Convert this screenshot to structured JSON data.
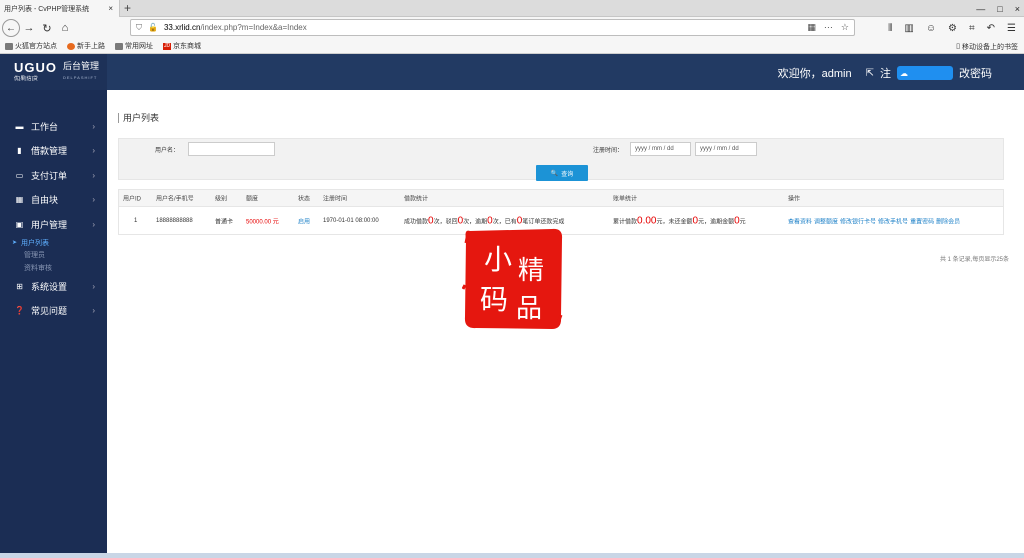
{
  "browser": {
    "tab_title": "用户列表 - CvPHP管理系统",
    "tab_close": "×",
    "new_tab": "+",
    "win_controls": [
      "—",
      "□",
      "×"
    ],
    "url_host": "33.xrlid.cn",
    "url_path": "/index.php?m=Index&a=Index",
    "bookmarks": [
      "火狐官方站点",
      "新手上路",
      "常用网址",
      "京东商城"
    ],
    "bookmark_right": "移动设备上的书签"
  },
  "header": {
    "logo_mark": "UGUO",
    "logo_sub": "优|果|信|贷",
    "logo_title": "后台管理",
    "logo_title_sub": "DELPASHIFT",
    "welcome": "欢迎你，admin",
    "logout_label": "注",
    "change_pwd": "改密码"
  },
  "sidebar": {
    "items": [
      {
        "label": "工作台",
        "icon": "monitor-icon"
      },
      {
        "label": "借款管理",
        "icon": "book-icon"
      },
      {
        "label": "支付订单",
        "icon": "card-icon"
      },
      {
        "label": "自由块",
        "icon": "grid-icon"
      },
      {
        "label": "用户管理",
        "icon": "user-icon"
      },
      {
        "label": "系统设置",
        "icon": "windows-icon"
      },
      {
        "label": "常见问题",
        "icon": "question-icon"
      }
    ],
    "sub_items": [
      "用户列表",
      "管理员",
      "资料审核"
    ]
  },
  "page": {
    "title": "用户列表",
    "filter": {
      "username_label": "用户名：",
      "regtime_label": "注册时间：",
      "date_placeholder": "yyyy / mm / dd",
      "search_label": "查询"
    },
    "table": {
      "headers": [
        "用户ID",
        "用户名/手机号",
        "级别",
        "额度",
        "状态",
        "注册时间",
        "借款统计",
        "账单统计",
        "操作"
      ],
      "row": {
        "id": "1",
        "username": "18888888888",
        "level": "普通卡",
        "quota": "50000.00 元",
        "status": "启用",
        "regtime": "1970-01-01 08:00:00",
        "loan_stat": {
          "p1": "成功借款",
          "v1": "0",
          "p2": "次，驳回",
          "v2": "0",
          "p3": "次，逾期",
          "v3": "0",
          "p4": "次，已有",
          "v4": "0",
          "p5": "笔订单还款完成"
        },
        "bill_stat": {
          "p1": "累计借款",
          "v1": "0.00",
          "p2": "元，未还金额",
          "v2": "0",
          "p3": "元，逾期金额",
          "v3": "0",
          "p4": "元"
        },
        "ops": [
          "查看资料",
          "调整额度",
          "修改银行卡号",
          "修改手机号",
          "重置密码",
          "删除会员"
        ]
      }
    },
    "pager": "共 1 条记录,每页显示25条"
  },
  "stamp": [
    "小",
    "精",
    "码",
    "品"
  ]
}
